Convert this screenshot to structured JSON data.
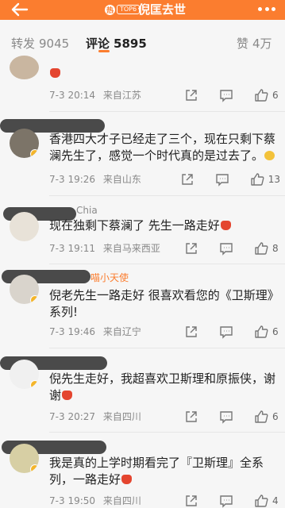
{
  "header": {
    "title": "倪匡去世",
    "hot_badge": "热",
    "hot_rank": "TOP6"
  },
  "tabs": {
    "reposts": {
      "label": "转发",
      "count": "9045"
    },
    "comments": {
      "label": "评论",
      "count": "5895"
    },
    "likes": {
      "label": "赞",
      "count": "4万"
    }
  },
  "comments": [
    {
      "username": "",
      "text": "",
      "date": "7-3",
      "time": "20:14",
      "location": "来自江苏",
      "likes": "6"
    },
    {
      "username": "",
      "text": "香港四大才子已经走了三个，现在只剩下蔡澜先生了，感觉一个时代真的是过去了。",
      "date": "7-3",
      "time": "19:26",
      "location": "来自山东",
      "likes": "13"
    },
    {
      "username": "Chia",
      "text": "现在独剩下蔡澜了 先生一路走好",
      "date": "7-3",
      "time": "19:11",
      "location": "来自马来西亚",
      "likes": "8"
    },
    {
      "username": "喵小天使",
      "text": "倪老先生一路走好 很喜欢看您的《卫斯理》系列!",
      "date": "7-3",
      "time": "19:46",
      "location": "来自辽宁",
      "likes": "6"
    },
    {
      "username": "",
      "text": "倪先生走好，我超喜欢卫斯理和原振侠，谢谢",
      "date": "7-3",
      "time": "20:27",
      "location": "来自四川",
      "likes": "6"
    },
    {
      "username": "",
      "text": "我是真的上学时期看完了『卫斯理』全系列，一路走好",
      "date": "7-3",
      "time": "19:50",
      "location": "来自四川",
      "likes": "4"
    }
  ],
  "colors": {
    "accent": "#fb7d2f",
    "background": "#f6f6f6"
  },
  "icons": [
    "back-arrow-icon",
    "more-dots-icon",
    "share-icon",
    "reply-icon",
    "like-icon",
    "emoji-icon"
  ]
}
